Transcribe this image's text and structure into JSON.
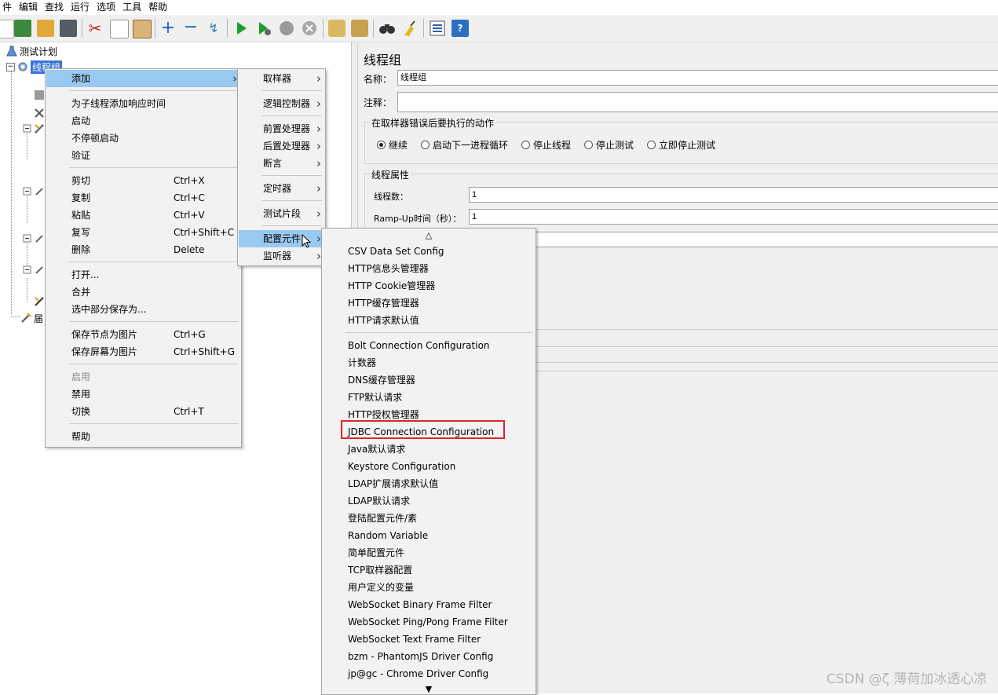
{
  "menubar": [
    "件",
    "编辑",
    "查找",
    "运行",
    "选项",
    "工具",
    "帮助"
  ],
  "tree": {
    "root": "测试计划",
    "selected": "线程组",
    "partial_label": "届"
  },
  "context_menu": {
    "items": [
      {
        "label": "添加",
        "accel": "",
        "submenu": true,
        "highlight": true
      },
      {
        "sep": true
      },
      {
        "label": "为子线程添加响应时间",
        "accel": ""
      },
      {
        "label": "启动",
        "accel": ""
      },
      {
        "label": "不停顿启动",
        "accel": ""
      },
      {
        "label": "验证",
        "accel": ""
      },
      {
        "sep": true
      },
      {
        "label": "剪切",
        "accel": "Ctrl+X"
      },
      {
        "label": "复制",
        "accel": "Ctrl+C"
      },
      {
        "label": "粘贴",
        "accel": "Ctrl+V"
      },
      {
        "label": "复写",
        "accel": "Ctrl+Shift+C"
      },
      {
        "label": "删除",
        "accel": "Delete"
      },
      {
        "sep": true
      },
      {
        "label": "打开...",
        "accel": ""
      },
      {
        "label": "合并",
        "accel": ""
      },
      {
        "label": "选中部分保存为...",
        "accel": ""
      },
      {
        "sep": true
      },
      {
        "label": "保存节点为图片",
        "accel": "Ctrl+G"
      },
      {
        "label": "保存屏幕为图片",
        "accel": "Ctrl+Shift+G"
      },
      {
        "sep": true
      },
      {
        "label": "启用",
        "accel": "",
        "disabled": true
      },
      {
        "label": "禁用",
        "accel": ""
      },
      {
        "label": "切换",
        "accel": "Ctrl+T"
      },
      {
        "sep": true
      },
      {
        "label": "帮助",
        "accel": ""
      }
    ]
  },
  "add_submenu": {
    "items": [
      {
        "label": "取样器",
        "submenu": true
      },
      {
        "sep": true
      },
      {
        "label": "逻辑控制器",
        "submenu": true
      },
      {
        "sep": true
      },
      {
        "label": "前置处理器",
        "submenu": true
      },
      {
        "label": "后置处理器",
        "submenu": true
      },
      {
        "label": "断言",
        "submenu": true
      },
      {
        "sep": true
      },
      {
        "label": "定时器",
        "submenu": true
      },
      {
        "sep": true
      },
      {
        "label": "测试片段",
        "submenu": true
      },
      {
        "sep": true
      },
      {
        "label": "配置元件",
        "submenu": true,
        "highlight": true
      },
      {
        "label": "监听器",
        "submenu": true
      }
    ]
  },
  "config_submenu": {
    "scroll_up": "△",
    "scroll_down": "▼",
    "items": [
      {
        "label": "CSV Data Set Config"
      },
      {
        "label": "HTTP信息头管理器"
      },
      {
        "label": "HTTP Cookie管理器"
      },
      {
        "label": "HTTP缓存管理器"
      },
      {
        "label": "HTTP请求默认值"
      },
      {
        "sep": true
      },
      {
        "label": "Bolt Connection Configuration"
      },
      {
        "label": "计数器"
      },
      {
        "label": "DNS缓存管理器"
      },
      {
        "label": "FTP默认请求"
      },
      {
        "label": "HTTP授权管理器"
      },
      {
        "label": "JDBC Connection Configuration",
        "boxed": true
      },
      {
        "label": "Java默认请求"
      },
      {
        "label": "Keystore Configuration"
      },
      {
        "label": "LDAP扩展请求默认值"
      },
      {
        "label": "LDAP默认请求"
      },
      {
        "label": "登陆配置元件/素"
      },
      {
        "label": "Random Variable"
      },
      {
        "label": "简单配置元件"
      },
      {
        "label": "TCP取样器配置"
      },
      {
        "label": "用户定义的变量"
      },
      {
        "label": "WebSocket Binary Frame Filter"
      },
      {
        "label": "WebSocket Ping/Pong Frame Filter"
      },
      {
        "label": "WebSocket Text Frame Filter"
      },
      {
        "label": "bzm - PhantomJS Driver Config"
      },
      {
        "label": "jp@gc - Chrome Driver Config"
      }
    ]
  },
  "panel": {
    "title": "线程组",
    "name_label": "名称：",
    "name_value": "线程组",
    "comment_label": "注释：",
    "error_group_title": "在取样器错误后要执行的动作",
    "error_options": [
      {
        "label": "继续",
        "selected": true
      },
      {
        "label": "启动下一进程循环",
        "selected": false
      },
      {
        "label": "停止线程",
        "selected": false
      },
      {
        "label": "停止测试",
        "selected": false
      },
      {
        "label": "立即停止测试",
        "selected": false
      }
    ],
    "thread_group_title": "线程属性",
    "threads_label": "线程数：",
    "threads_value": "1",
    "rampup_label": "Ramp-Up时间（秒）：",
    "rampup_value": "1"
  },
  "watermark": "CSDN @ζ 薄荷加冰透心凉"
}
